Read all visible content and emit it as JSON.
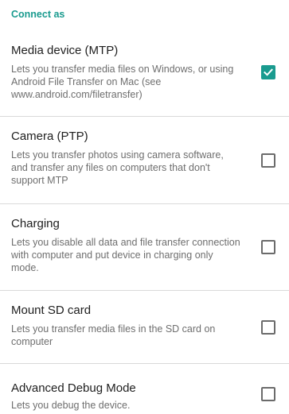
{
  "header": {
    "label": "Connect as"
  },
  "options": [
    {
      "title": "Media device (MTP)",
      "summary": "Lets you transfer media files on Windows, or using Android File Transfer on Mac (see www.android.com/filetransfer)",
      "checked": true
    },
    {
      "title": "Camera (PTP)",
      "summary": "Lets you transfer photos using camera software, and transfer any files on computers that don't support MTP",
      "checked": false
    },
    {
      "title": "Charging",
      "summary": "Lets you disable all data and file transfer connection with computer and put device in charging only mode.",
      "checked": false
    },
    {
      "title": "Mount SD card",
      "summary": "Lets you transfer media files in the SD card on computer",
      "checked": false
    },
    {
      "title": "Advanced Debug Mode",
      "summary": "Lets you debug the device.",
      "checked": false
    }
  ],
  "colors": {
    "accent": "#1a9b8f",
    "title_text": "#202020",
    "summary_text": "#6e6e6e",
    "divider": "#d9d9d9"
  }
}
